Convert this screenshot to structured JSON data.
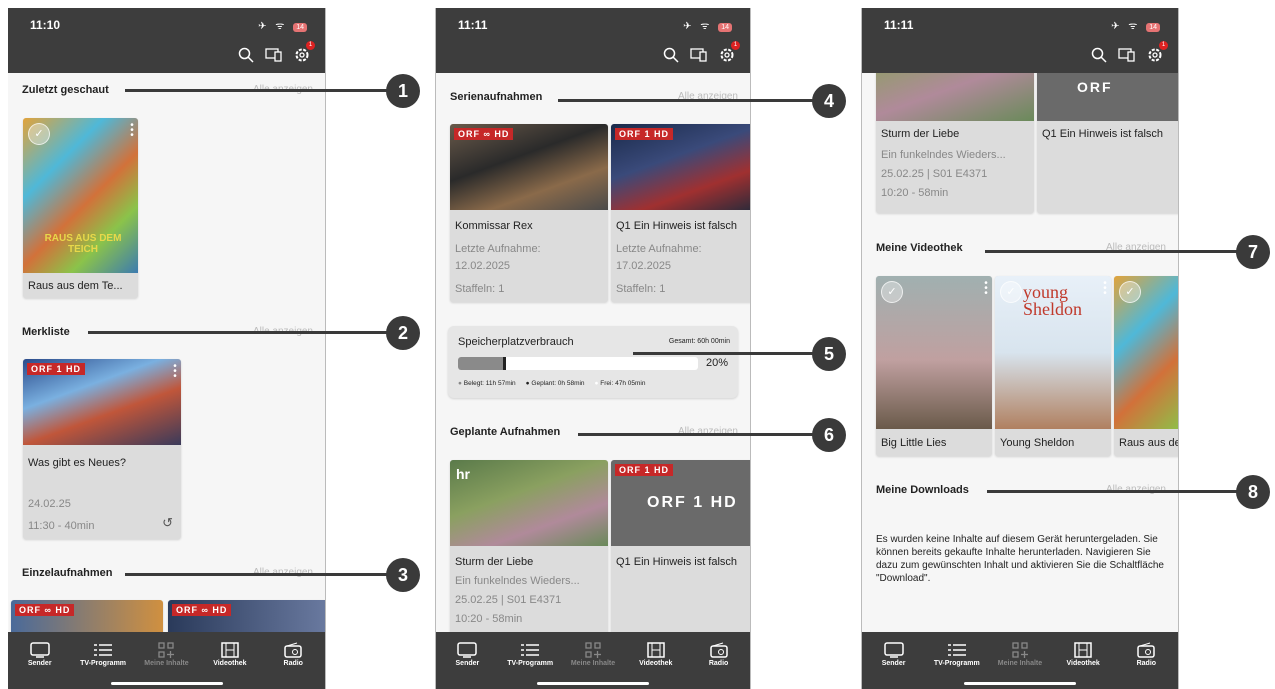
{
  "screens": [
    {
      "time": "11:10",
      "battery": "14",
      "sections": {
        "zuletzt": "Zuletzt geschaut",
        "zuletzt_all": "Alle anzeigen",
        "merkliste": "Merkliste",
        "merkliste_all": "Alle anzeigen",
        "einzel": "Einzelaufnahmen",
        "einzel_all": "Alle anzeigen"
      },
      "card_raus": {
        "title": "Raus aus dem Te...",
        "poster_text": "RAUS AUS DEM TEICH"
      },
      "card_neues": {
        "logo": "ORF 1 HD",
        "title": "Was gibt es Neues?",
        "date": "24.02.25",
        "time": "11:30 - 40min"
      },
      "einzel_logos": [
        "ORF ∞ HD",
        "ORF ∞ HD"
      ]
    },
    {
      "time": "11:11",
      "battery": "14",
      "sections": {
        "serien": "Serienaufnahmen",
        "serien_all": "Alle anzeigen",
        "geplant": "Geplante Aufnahmen",
        "geplant_all": "Alle anzeigen"
      },
      "serien": [
        {
          "logo": "ORF ∞ HD",
          "title": "Kommissar Rex",
          "sub1": "Letzte Aufnahme:",
          "sub2": "12.02.2025",
          "sub3": "Staffeln: 1"
        },
        {
          "logo": "ORF 1 HD",
          "title": "Q1 Ein Hinweis ist falsch",
          "sub1": "Letzte Aufnahme:",
          "sub2": "17.02.2025",
          "sub3": "Staffeln: 1"
        }
      ],
      "storage": {
        "title": "Speicherplatzverbrauch",
        "total": "Gesamt: 60h 00min",
        "percent": "20%",
        "fill": 0.2,
        "belegt": "Belegt: 11h 57min",
        "geplant": "Geplant: 0h 58min",
        "frei": "Frei: 47h 05min"
      },
      "geplant": [
        {
          "logo": "hr",
          "title": "Sturm der Liebe",
          "sub1": "Ein funkelndes Wieders...",
          "sub2": "25.02.25 | S01 E4371",
          "sub3": "10:20 - 58min"
        },
        {
          "logo": "ORF 1 HD",
          "title": "Q1 Ein Hinweis ist falsch",
          "big_logo": "ORF 1 HD"
        }
      ]
    },
    {
      "time": "11:11",
      "battery": "14",
      "top_cards": [
        {
          "title": "Sturm der Liebe",
          "sub1": "Ein funkelndes Wieders...",
          "sub2": "25.02.25 | S01 E4371",
          "sub3": "10:20 - 58min",
          "logo": "ORF"
        },
        {
          "title": "Q1 Ein Hinweis ist falsch"
        }
      ],
      "sections": {
        "videothek": "Meine Videothek",
        "videothek_all": "Alle anzeigen",
        "downloads": "Meine Downloads",
        "downloads_all": "Alle anzeigen"
      },
      "videothek": [
        {
          "title": "Big Little Lies"
        },
        {
          "title": "Young Sheldon",
          "poster": "young Sheldon"
        },
        {
          "title": "Raus aus de"
        }
      ],
      "downloads_text": "Es wurden keine Inhalte auf diesem Gerät heruntergeladen. Sie können bereits gekaufte Inhalte herunterladen. Navigieren Sie dazu zum gewünschten Inhalt und aktivieren Sie die Schaltfläche \"Download\"."
    }
  ],
  "nav": [
    {
      "label": "Sender"
    },
    {
      "label": "TV-Programm"
    },
    {
      "label": "Meine Inhalte"
    },
    {
      "label": "Videothek"
    },
    {
      "label": "Radio"
    }
  ],
  "callouts": [
    "1",
    "2",
    "3",
    "4",
    "5",
    "6",
    "7",
    "8"
  ]
}
